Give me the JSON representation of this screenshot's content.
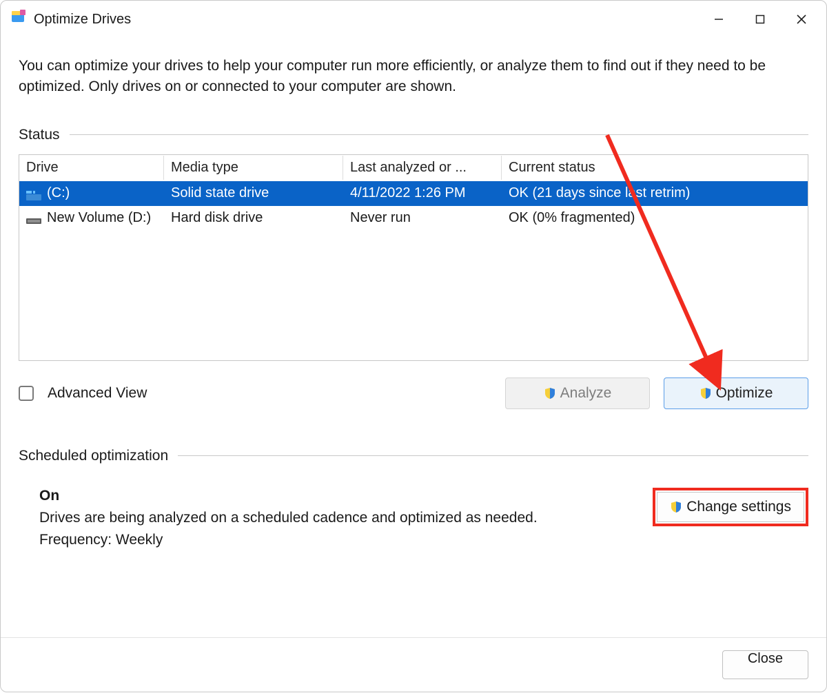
{
  "window_title": "Optimize Drives",
  "intro_text": "You can optimize your drives to help your computer run more efficiently, or analyze them to find out if they need to be optimized. Only drives on or connected to your computer are shown.",
  "status_section_label": "Status",
  "columns": {
    "drive": "Drive",
    "media_type": "Media type",
    "last_analyzed": "Last analyzed or ...",
    "current_status": "Current status"
  },
  "drives": [
    {
      "name": "(C:)",
      "media_type": "Solid state drive",
      "last_analyzed": "4/11/2022 1:26 PM",
      "current_status": "OK (21 days since last retrim)",
      "selected": true,
      "icon": "ssd"
    },
    {
      "name": "New Volume (D:)",
      "media_type": "Hard disk drive",
      "last_analyzed": "Never run",
      "current_status": "OK (0% fragmented)",
      "selected": false,
      "icon": "hdd"
    }
  ],
  "advanced_view_label": "Advanced View",
  "advanced_view_checked": false,
  "analyze_button": "Analyze",
  "optimize_button": "Optimize",
  "scheduled_section_label": "Scheduled optimization",
  "scheduled": {
    "state": "On",
    "description": "Drives are being analyzed on a scheduled cadence and optimized as needed.",
    "frequency_label": "Frequency: Weekly"
  },
  "change_settings_button": "Change settings",
  "close_button": "Close",
  "annotations": {
    "arrow_color": "#f02b1f",
    "highlight_color": "#f02b1f"
  }
}
